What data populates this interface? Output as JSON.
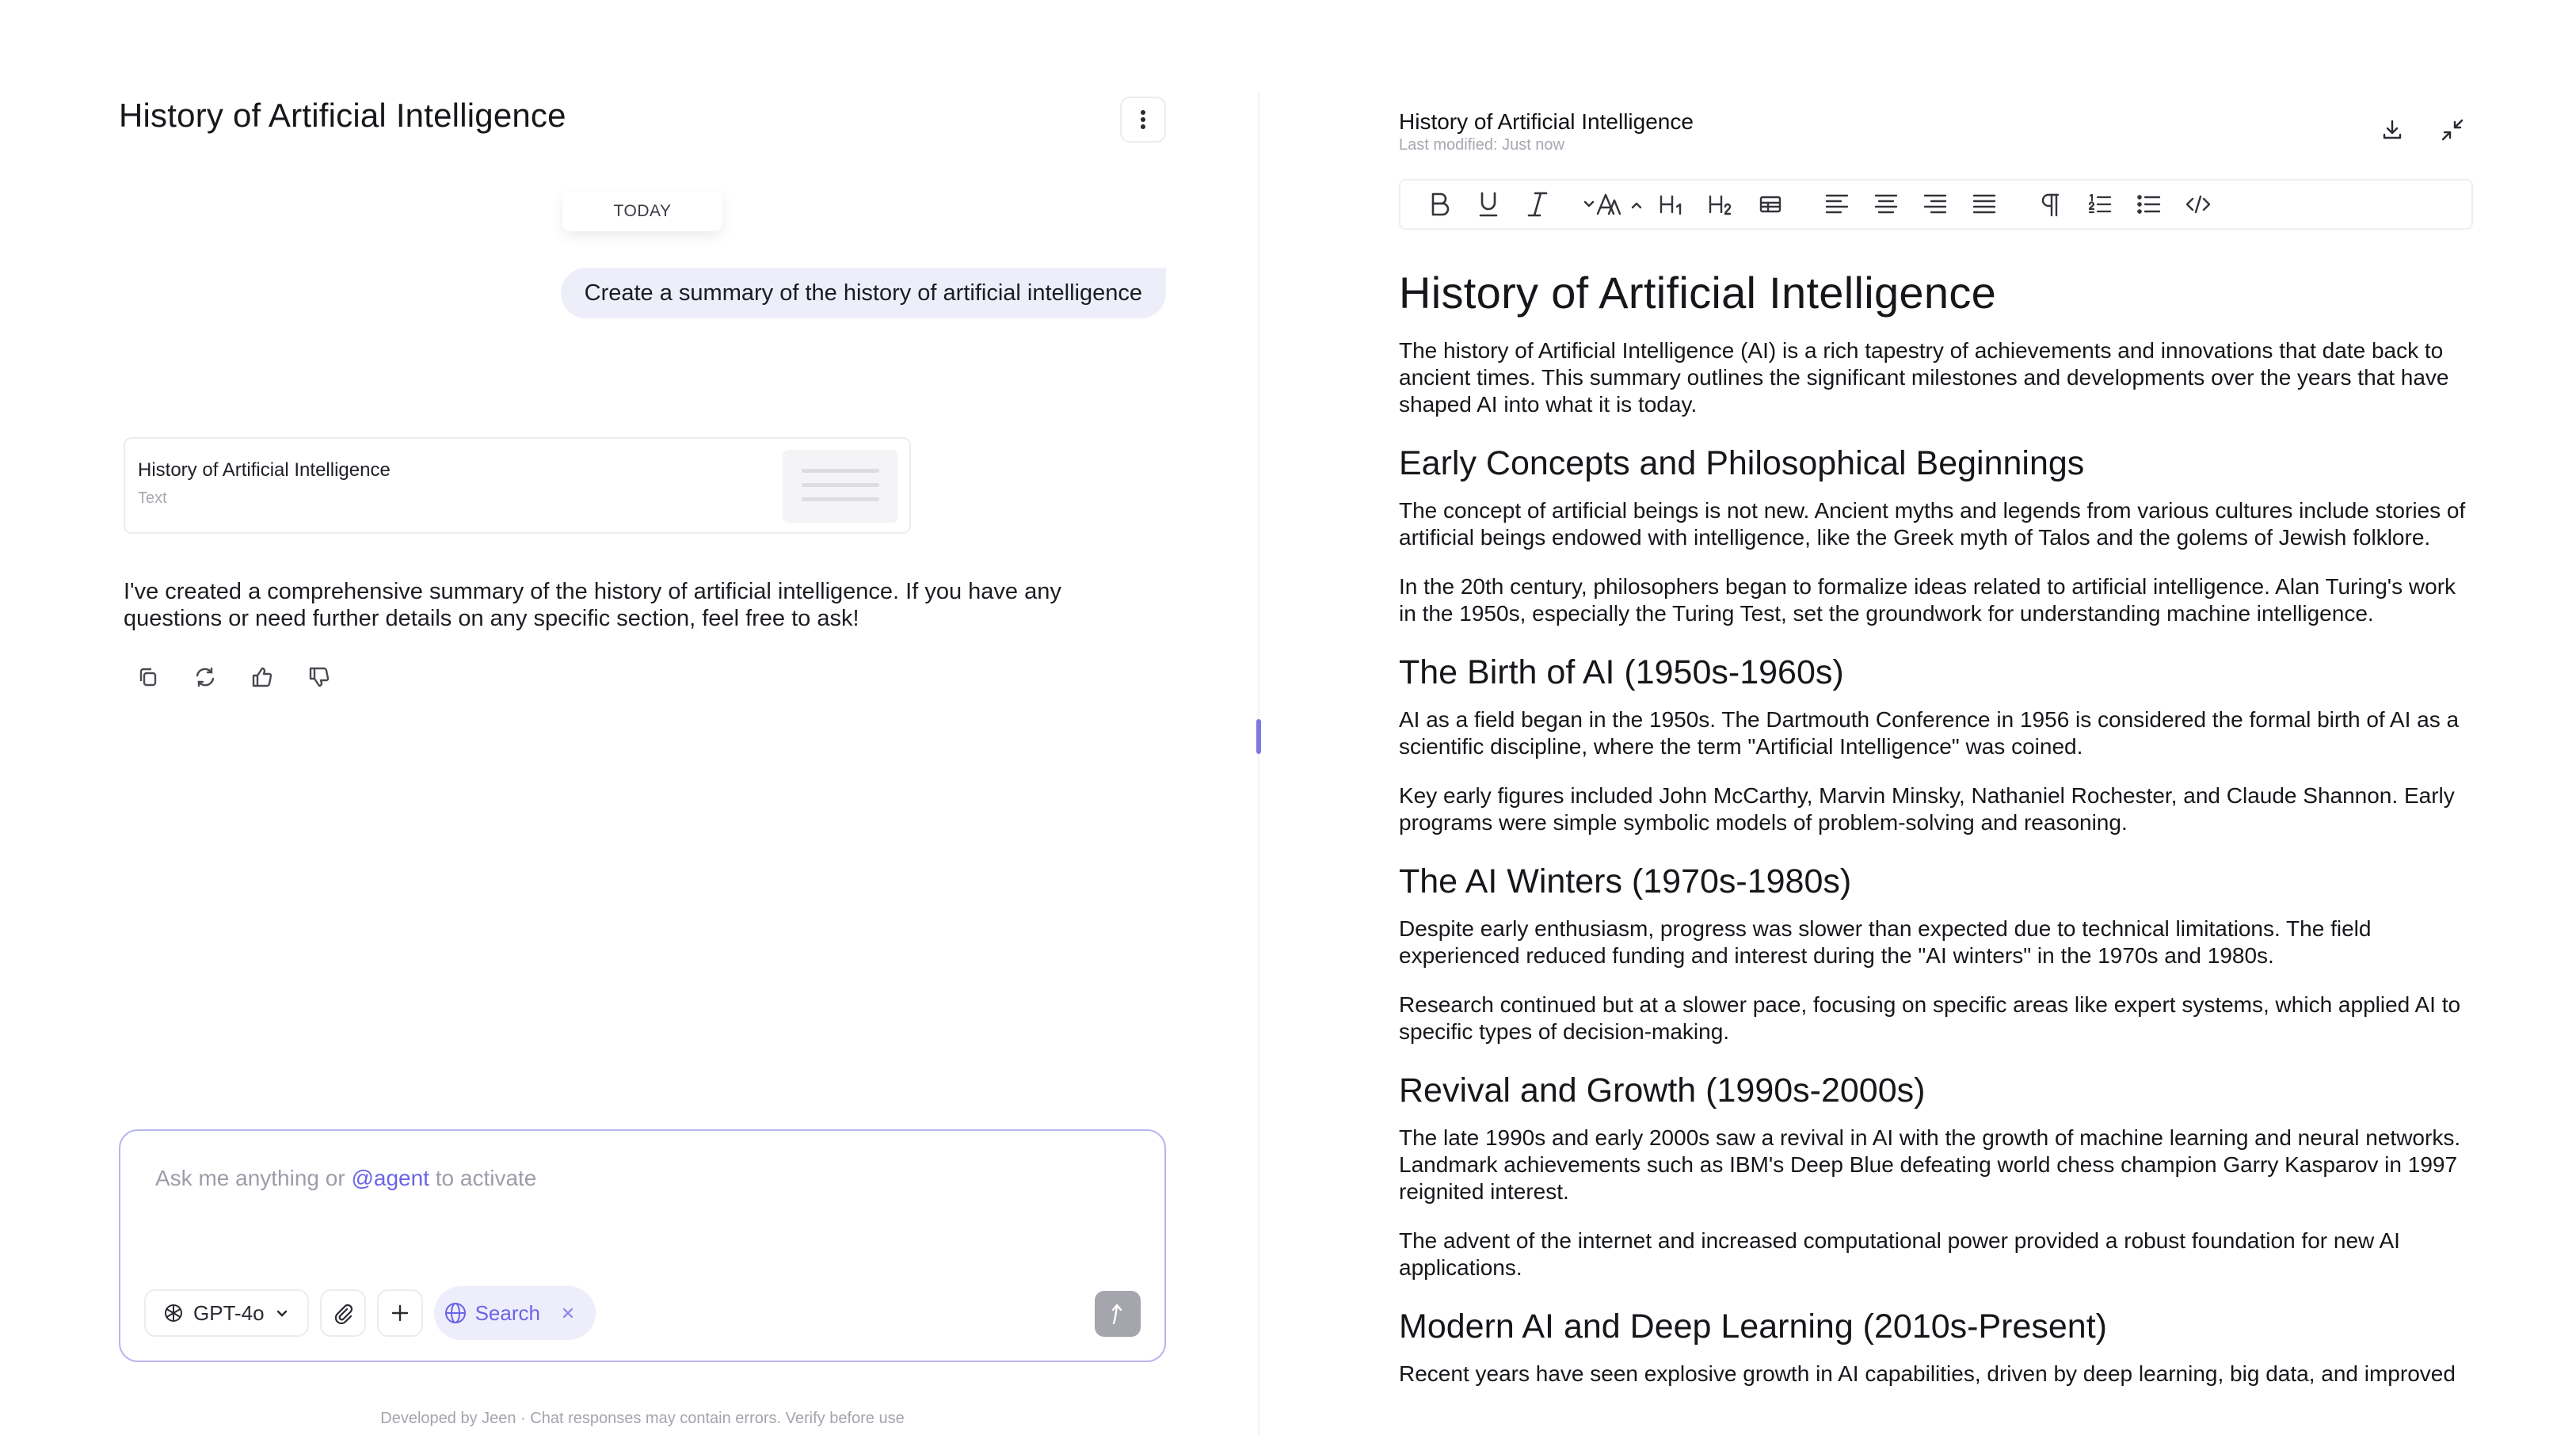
{
  "chat": {
    "title": "History of Artificial Intelligence",
    "date_label": "TODAY",
    "user_message": "Create a summary of the history of artificial intelligence",
    "artifact": {
      "title": "History of Artificial Intelligence",
      "type": "Text"
    },
    "assistant_message": "I've created a comprehensive summary of the history of artificial intelligence. If you have any questions or need further details on any specific section, feel free to ask!",
    "action_icons": [
      "copy-icon",
      "regenerate-icon",
      "thumbs-up-icon",
      "thumbs-down-icon"
    ]
  },
  "composer": {
    "placeholder_prefix": "Ask me anything or",
    "placeholder_agent": "@agent",
    "placeholder_suffix": "to activate",
    "model": "GPT-4o",
    "search_label": "Search"
  },
  "footer": {
    "note": "Developed by Jeen · Chat responses may contain errors. Verify before use"
  },
  "document": {
    "header_title": "History of Artificial Intelligence",
    "last_modified": "Last modified: Just now",
    "title": "History of Artificial Intelligence",
    "intro": "The history of Artificial Intelligence (AI) is a rich tapestry of achievements and innovations that date back to ancient times. This summary outlines the significant milestones and developments over the years that have shaped AI into what it is today.",
    "sections": [
      {
        "heading": "Early Concepts and Philosophical Beginnings",
        "paragraphs": [
          "The concept of artificial beings is not new. Ancient myths and legends from various cultures include stories of artificial beings endowed with intelligence, like the Greek myth of Talos and the golems of Jewish folklore.",
          "In the 20th century, philosophers began to formalize ideas related to artificial intelligence. Alan Turing's work in the 1950s, especially the Turing Test, set the groundwork for understanding machine intelligence."
        ]
      },
      {
        "heading": "The Birth of AI (1950s-1960s)",
        "paragraphs": [
          "AI as a field began in the 1950s. The Dartmouth Conference in 1956 is considered the formal birth of AI as a scientific discipline, where the term \"Artificial Intelligence\" was coined.",
          "Key early figures included John McCarthy, Marvin Minsky, Nathaniel Rochester, and Claude Shannon. Early programs were simple symbolic models of problem-solving and reasoning."
        ]
      },
      {
        "heading": "The AI Winters (1970s-1980s)",
        "paragraphs": [
          "Despite early enthusiasm, progress was slower than expected due to technical limitations. The field experienced reduced funding and interest during the \"AI winters\" in the 1970s and 1980s.",
          "Research continued but at a slower pace, focusing on specific areas like expert systems, which applied AI to specific types of decision-making."
        ]
      },
      {
        "heading": "Revival and Growth (1990s-2000s)",
        "paragraphs": [
          "The late 1990s and early 2000s saw a revival in AI with the growth of machine learning and neural networks. Landmark achievements such as IBM's Deep Blue defeating world chess champion Garry Kasparov in 1997 reignited interest.",
          "The advent of the internet and increased computational power provided a robust foundation for new AI applications."
        ]
      },
      {
        "heading": "Modern AI and Deep Learning (2010s-Present)",
        "paragraphs": [
          "Recent years have seen explosive growth in AI capabilities, driven by deep learning, big data, and improved"
        ]
      }
    ]
  },
  "toolbar": {
    "items": [
      "bold",
      "underline",
      "italic",
      "font-size",
      "heading-1",
      "heading-2",
      "table",
      "align-left",
      "align-center",
      "align-right",
      "align-justify",
      "paragraph",
      "ordered-list",
      "bullet-list",
      "code"
    ],
    "h1_label": "H1",
    "h2_label": "H2"
  },
  "colors": {
    "accent": "#6a64e6",
    "user_bubble": "#eeeefb",
    "composer_border": "#b8b6ee",
    "send_button": "#a5a5ad"
  }
}
